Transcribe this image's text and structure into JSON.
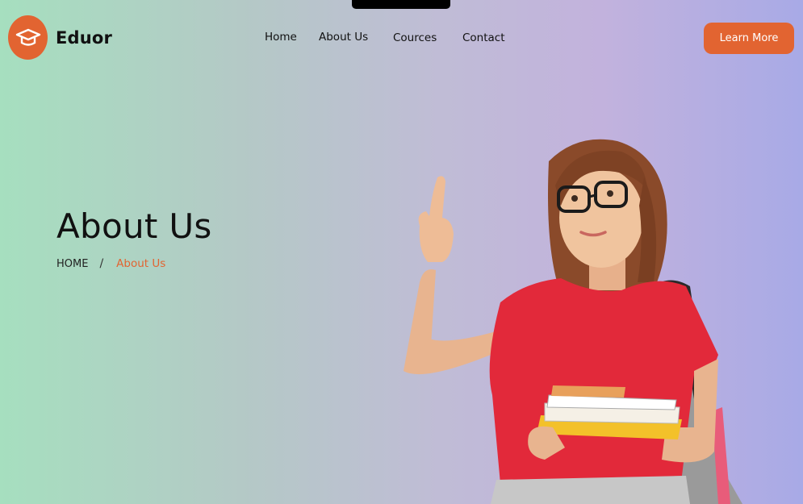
{
  "brand": {
    "name": "Eduor",
    "icon": "graduation-cap-icon",
    "accent": "#e26431"
  },
  "nav": {
    "items": [
      "Home",
      "About Us",
      "Cources",
      "Contact"
    ]
  },
  "cta": {
    "label": "Learn More"
  },
  "hero": {
    "title": "About Us",
    "breadcrumb": {
      "home": "HOME",
      "separator": "/",
      "current": "About Us"
    }
  }
}
